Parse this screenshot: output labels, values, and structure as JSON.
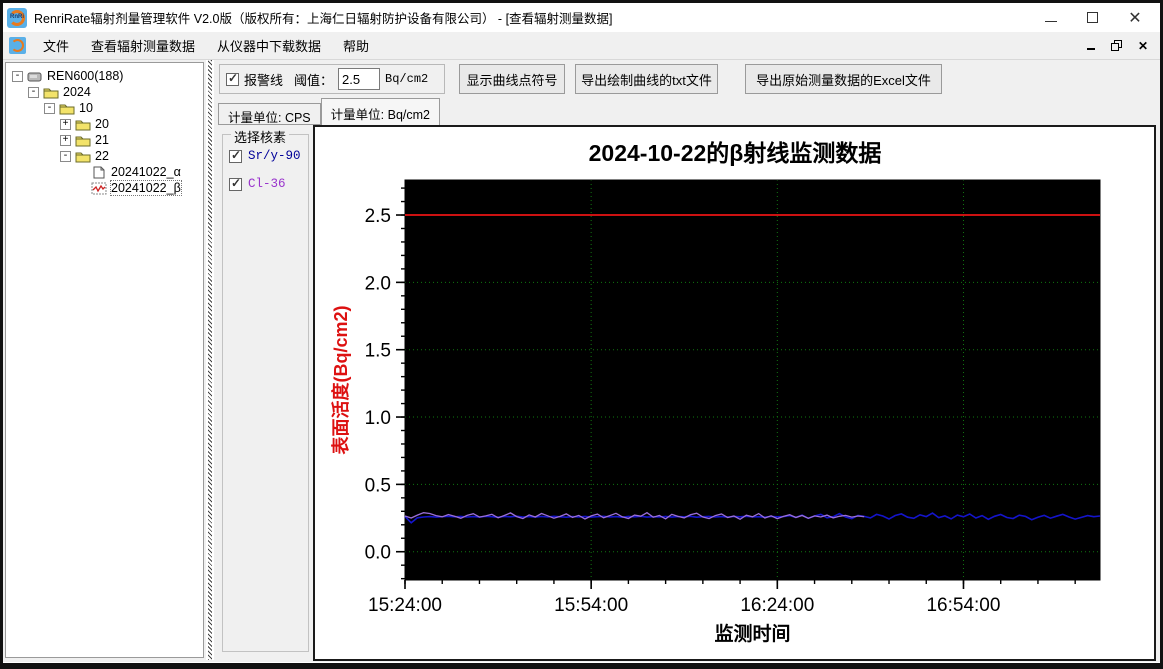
{
  "window": {
    "title": "RenriRate辐射剂量管理软件 V2.0版（版权所有：上海仁日辐射防护设备有限公司） - [查看辐射测量数据]",
    "controls": {
      "minimize": "minimize",
      "maximize": "maximize",
      "close": "✕"
    }
  },
  "menu": {
    "items": [
      "文件",
      "查看辐射测量数据",
      "从仪器中下载数据",
      "帮助"
    ]
  },
  "sidebar": {
    "tree": [
      {
        "depth": 0,
        "toggle": "-",
        "icon": "device",
        "label": "REN600(188)"
      },
      {
        "depth": 1,
        "toggle": "-",
        "icon": "folder",
        "label": "2024"
      },
      {
        "depth": 2,
        "toggle": "-",
        "icon": "folder",
        "label": "10"
      },
      {
        "depth": 3,
        "toggle": "+",
        "icon": "folder",
        "label": "20"
      },
      {
        "depth": 3,
        "toggle": "+",
        "icon": "folder",
        "label": "21"
      },
      {
        "depth": 3,
        "toggle": "-",
        "icon": "folder",
        "label": "22"
      },
      {
        "depth": 4,
        "toggle": "",
        "icon": "doc",
        "label": "20241022_α",
        "selected": false
      },
      {
        "depth": 4,
        "toggle": "",
        "icon": "chart",
        "label": "20241022_β",
        "selected": true
      }
    ]
  },
  "toolbar": {
    "alarm_checkbox_label": "报警线",
    "alarm_checked": true,
    "threshold_label": "阈值：",
    "threshold_value": "2.5",
    "threshold_unit": "Bq/cm2",
    "show_points_button": "显示曲线点符号",
    "export_txt_button": "导出绘制曲线的txt文件",
    "export_excel_button": "导出原始测量数据的Excel文件"
  },
  "tabs": [
    {
      "label": "计量单位: CPS",
      "active": false
    },
    {
      "label": "计量单位: Bq/cm2",
      "active": true
    }
  ],
  "nuclide_panel": {
    "legend": "选择核素",
    "items": [
      {
        "label": "Sr/y-90",
        "checked": true,
        "color": "#000099"
      },
      {
        "label": "Cl-36",
        "checked": true,
        "color": "#9933cc"
      }
    ]
  },
  "chart_data": {
    "type": "line",
    "title": "2024-10-22的β射线监测数据",
    "xlabel": "监测时间",
    "ylabel": "表面活度(Bq/cm2)",
    "plot_bg": "#000000",
    "grid_color": "#117711",
    "alarm_color": "#cc1111",
    "axis_title_color": "#dd1111",
    "alarm_line_value": 2.5,
    "ylim": [
      -0.21,
      2.76
    ],
    "y_major_ticks": [
      0,
      0.5,
      1,
      1.5,
      2,
      2.5
    ],
    "y_major_tick_labels": [
      "0.0",
      "0.5",
      "1.0",
      "1.5",
      "2.0",
      "2.5"
    ],
    "y_minor_step": 0.1,
    "y_minor_range": [
      -0.2,
      2.7
    ],
    "x_minutes_range": [
      0,
      112
    ],
    "x_major_ticks_minutes": [
      0,
      30,
      60,
      90
    ],
    "x_major_tick_labels": [
      "15:24:00",
      "15:54:00",
      "16:24:00",
      "16:54:00"
    ],
    "x_minor_step_minutes": 6,
    "series": [
      {
        "name": "Sr/y-90",
        "color": "#1414cc",
        "width": 1.6,
        "start_minute": 0,
        "step_minutes": 1,
        "values": [
          0.262,
          0.215,
          0.252,
          0.258,
          0.261,
          0.257,
          0.26,
          0.263,
          0.259,
          0.262,
          0.258,
          0.261,
          0.257,
          0.263,
          0.26,
          0.256,
          0.262,
          0.259,
          0.264,
          0.258,
          0.261,
          0.257,
          0.262,
          0.258,
          0.263,
          0.259,
          0.256,
          0.261,
          0.258,
          0.262,
          0.257,
          0.26,
          0.263,
          0.258,
          0.261,
          0.256,
          0.262,
          0.259,
          0.263,
          0.257,
          0.26,
          0.258,
          0.262,
          0.257,
          0.261,
          0.259,
          0.263,
          0.256,
          0.26,
          0.262,
          0.258,
          0.261,
          0.257,
          0.262,
          0.259,
          0.263,
          0.258,
          0.26,
          0.256,
          0.262,
          0.259,
          0.261,
          0.268,
          0.255,
          0.272,
          0.248,
          0.265,
          0.278,
          0.252,
          0.26,
          0.283,
          0.258,
          0.246,
          0.27,
          0.262,
          0.251,
          0.277,
          0.265,
          0.243,
          0.269,
          0.281,
          0.256,
          0.248,
          0.274,
          0.261,
          0.287,
          0.253,
          0.266,
          0.244,
          0.272,
          0.259,
          0.28,
          0.25,
          0.268,
          0.241,
          0.263,
          0.276,
          0.254,
          0.247,
          0.271,
          0.262,
          0.238,
          0.256,
          0.27,
          0.249,
          0.264,
          0.277,
          0.258,
          0.242,
          0.255,
          0.268,
          0.26,
          0.265
        ]
      },
      {
        "name": "Cl-36",
        "color": "#9a6fd8",
        "width": 1.3,
        "start_minute": 0,
        "step_minutes": 1,
        "values": [
          0.265,
          0.25,
          0.272,
          0.29,
          0.284,
          0.268,
          0.259,
          0.276,
          0.263,
          0.248,
          0.27,
          0.282,
          0.257,
          0.266,
          0.278,
          0.252,
          0.269,
          0.288,
          0.261,
          0.246,
          0.273,
          0.258,
          0.284,
          0.267,
          0.249,
          0.262,
          0.281,
          0.255,
          0.27,
          0.243,
          0.266,
          0.279,
          0.252,
          0.268,
          0.285,
          0.259,
          0.247,
          0.272,
          0.264,
          0.29,
          0.256,
          0.269,
          0.244,
          0.277,
          0.262,
          0.251,
          0.274,
          0.286,
          0.258,
          0.246,
          0.268,
          0.28,
          0.253,
          0.265,
          0.241,
          0.271,
          0.259,
          0.283,
          0.25,
          0.267,
          0.245,
          0.262,
          0.275,
          0.254,
          0.269,
          0.248,
          0.266,
          0.258,
          0.272,
          0.251,
          0.263,
          0.27,
          0.257,
          0.265,
          0.26
        ]
      }
    ]
  }
}
